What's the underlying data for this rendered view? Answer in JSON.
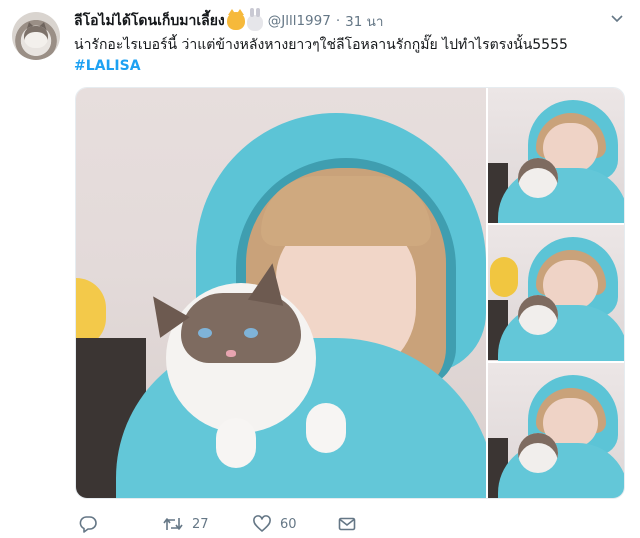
{
  "tweet": {
    "display_name": "ลีโอไม่ได้โดนเก็บมาเลี้ยง",
    "handle": "@Jlll1997",
    "separator": "·",
    "time": "31 นา",
    "text": "น่ารักอะไรเบอร์นี้ ว่าแต่ข้างหลังหางยาวๆใช่ลีโอหลานรักกูมั๊ย ไปทำไรตรงนั้น5555",
    "hashtag": "#LALISA",
    "emojis": [
      "cat-face-emoji",
      "rabbit-emoji"
    ]
  },
  "actions": {
    "reply_count": "",
    "retweet_count": "27",
    "like_count": "60"
  },
  "colors": {
    "link": "#1da1f2",
    "muted": "#657786",
    "text": "#14171a",
    "hoodie": "#5cc4d6"
  }
}
